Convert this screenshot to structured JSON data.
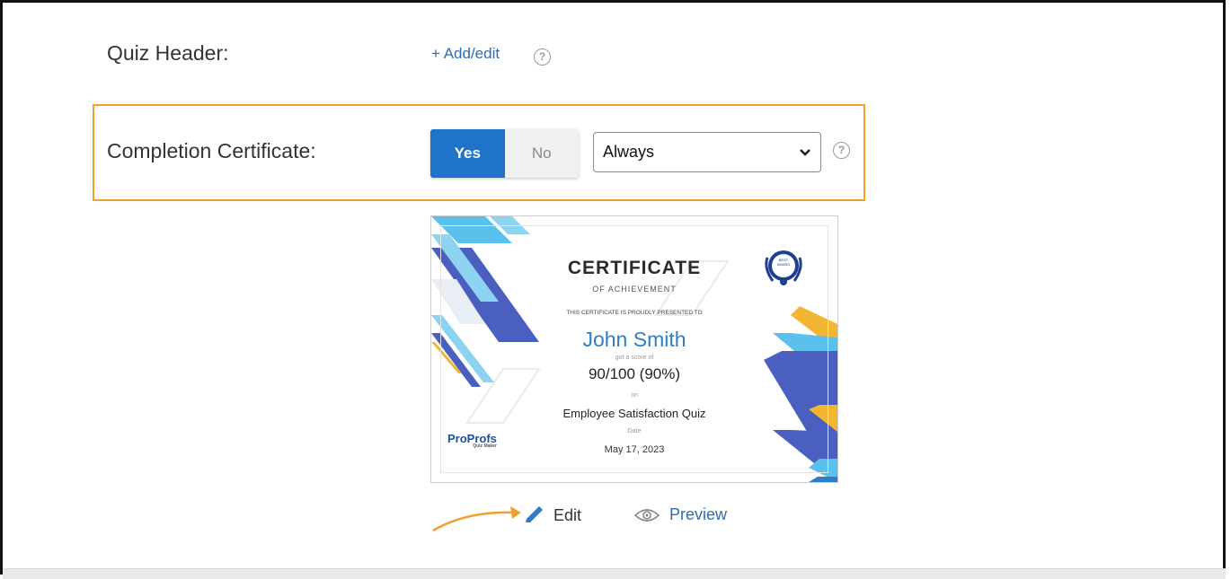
{
  "quiz_header": {
    "label": "Quiz Header:",
    "add_edit_link": "+ Add/edit",
    "help": "?"
  },
  "completion_certificate": {
    "label": "Completion Certificate:",
    "yes_label": "Yes",
    "no_label": "No",
    "selected": "Yes",
    "dropdown_value": "Always",
    "help": "?"
  },
  "certificate_preview": {
    "title": "CERTIFICATE",
    "subtitle": "OF ACHIEVEMENT",
    "presented_to": "THIS CERTIFICATE IS PROUDLY PRESENTED TO",
    "name": "John Smith",
    "score_caption": "got a score of",
    "score": "90/100 (90%)",
    "on_caption": "on",
    "quiz_name": "Employee Satisfaction Quiz",
    "date_caption": "Date",
    "date": "May 17, 2023",
    "brand_name": "ProProfs",
    "brand_sub": "Quiz Maker",
    "badge_text_1": "BEST",
    "badge_text_2": "AWARD"
  },
  "actions": {
    "edit_label": "Edit",
    "preview_label": "Preview"
  },
  "colors": {
    "accent_blue": "#1f73c8",
    "link_blue": "#2d6db0",
    "highlight_orange": "#f0a030",
    "cert_dark_blue": "#4a5fbf",
    "cert_light_blue": "#5bc0eb",
    "cert_yellow": "#f2b632"
  }
}
